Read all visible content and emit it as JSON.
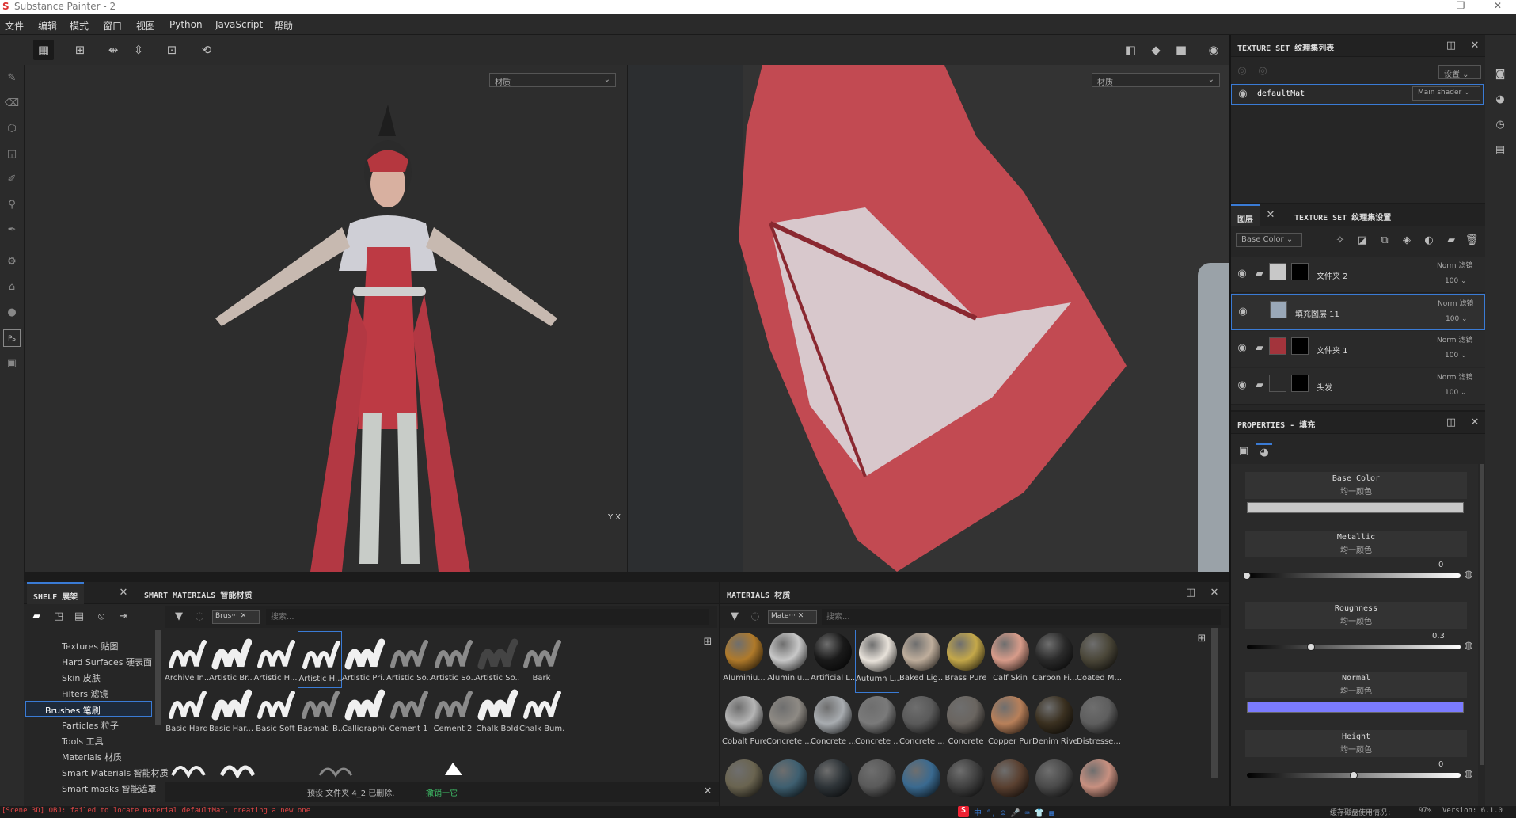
{
  "app": {
    "title": "Substance Painter - 2",
    "logo": "S"
  },
  "window_controls": [
    "—",
    "❐",
    "✕"
  ],
  "menu": [
    "文件",
    "编辑",
    "模式",
    "窗口",
    "视图",
    "Python",
    "JavaScript",
    "帮助"
  ],
  "viewport": {
    "left_mode": "材质",
    "right_mode": "材质",
    "axis_y": "Y",
    "axis_x": "X"
  },
  "shelf": {
    "tabs": [
      "SHELF 展架",
      "SMART MATERIALS 智能材质"
    ],
    "categories": [
      "Textures 贴图",
      "Hard Surfaces 硬表面",
      "Skin 皮肤",
      "Filters 滤镜",
      "Brushes 笔刷",
      "Particles 粒子",
      "Tools 工具",
      "Materials 材质",
      "Smart Materials 智能材质",
      "Smart masks 智能遮罩"
    ],
    "selected_category": "Brushes 笔刷",
    "filter_tag": "Brus···",
    "search_placeholder": "搜索...",
    "brushes_row1": [
      "Archive In...",
      "Artistic Br...",
      "Artistic H...",
      "Artistic H...",
      "Artistic Pri...",
      "Artistic So...",
      "Artistic So...",
      "Artistic So...",
      "Bark"
    ],
    "brushes_row2": [
      "Basic Hard",
      "Basic Har...",
      "Basic Soft",
      "Basmati B...",
      "Calligraphic",
      "Cement 1",
      "Cement 2",
      "Chalk Bold",
      "Chalk Bum..."
    ],
    "notify": {
      "text": "预设 文件夹 4_2 已删除.",
      "undo": "撤销一它"
    }
  },
  "materials": {
    "title": "MATERIALS 材质",
    "filter_tag": "Mate···",
    "search_placeholder": "搜索...",
    "row1": [
      "Aluminiu...",
      "Aluminiu...",
      "Artificial L...",
      "Autumn L...",
      "Baked Lig...",
      "Brass Pure",
      "Calf Skin",
      "Carbon Fi...",
      "Coated M..."
    ],
    "row2": [
      "Cobalt Pure",
      "Concrete ...",
      "Concrete ...",
      "Concrete ...",
      "Concrete ...",
      "Concrete",
      "Copper Pure",
      "Denim Rivet",
      "Distresse..."
    ],
    "colors1": [
      "#b07a2a",
      "#c8c8c8",
      "#1a1a1a",
      "#e8e2da",
      "#bfae9c",
      "#c4a84a",
      "#d89c8a",
      "#2a2a2a",
      "#4a4638"
    ],
    "colors2": [
      "#b5b5b5",
      "#8e8a84",
      "#a8acb0",
      "#7a7a7a",
      "#5a5a5a",
      "#6a6560",
      "#b8805a",
      "#3a3020",
      "#5e5e5e"
    ],
    "colors3": [
      "#6a6450",
      "#3e5f70",
      "#2e3438",
      "#5a5a5a",
      "#3a6a90",
      "#404040",
      "#5a4030",
      "#4a4a4a",
      "#c89080"
    ]
  },
  "texset_list": {
    "title": "TEXTURE SET 纹理集列表",
    "settings": "设置",
    "item": "defaultMat",
    "shader": "Main shader"
  },
  "layers": {
    "tabs": [
      "图层",
      "TEXTURE SET 纹理集设置"
    ],
    "channel": "Base Color",
    "items": [
      {
        "name": "文件夹 2",
        "blend": "Norm",
        "mode": "滤镜",
        "opacity": "100",
        "type": "folder"
      },
      {
        "name": "填充图层 11",
        "blend": "Norm",
        "mode": "滤镜",
        "opacity": "100",
        "type": "fill"
      },
      {
        "name": "文件夹 1",
        "blend": "Norm",
        "mode": "滤镜",
        "opacity": "100",
        "type": "folder"
      },
      {
        "name": "头发",
        "blend": "Norm",
        "mode": "滤镜",
        "opacity": "100",
        "type": "folder"
      }
    ]
  },
  "properties": {
    "title": "PROPERTIES - 填充",
    "channels": [
      {
        "name": "Base Color",
        "sub": "均一颜色",
        "value": ""
      },
      {
        "name": "Metallic",
        "sub": "均一颜色",
        "value": "0"
      },
      {
        "name": "Roughness",
        "sub": "均一颜色",
        "value": "0.3"
      },
      {
        "name": "Normal",
        "sub": "均一颜色",
        "value": ""
      },
      {
        "name": "Height",
        "sub": "均一颜色",
        "value": "0"
      }
    ],
    "roughness_level": 0.3,
    "height_level": 0.5
  },
  "status": {
    "error": "[Scene 3D] OBJ: failed to locate material defaultMat, creating a new one",
    "cache": "缓存磁盘使用情况:",
    "cache_pct": "97%",
    "version": "Version: 6.1.0"
  },
  "ime": [
    "中",
    "°,",
    "☺",
    "🎤",
    "⌨",
    "👕",
    "▦"
  ]
}
